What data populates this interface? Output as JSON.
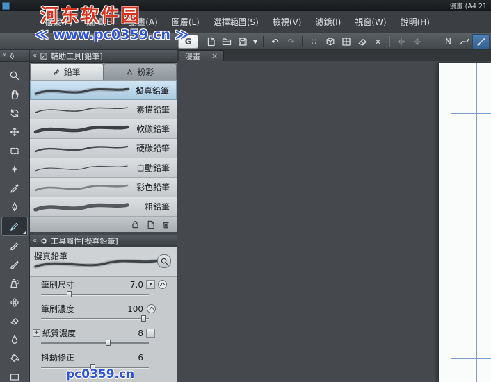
{
  "watermarks": {
    "top_title": "河东软件园",
    "top_url": "≪ www.pc0359.cn ≫",
    "bottom_url": "pc0359.cn"
  },
  "titlebar": {
    "title": "漫畫 (A4 21"
  },
  "menubar": {
    "items": [
      "檔案(F)",
      "編輯(E)",
      "動畫(A)",
      "圖層(L)",
      "選擇範圍(S)",
      "檢視(V)",
      "濾鏡(I)",
      "視窗(W)",
      "說明(H)"
    ]
  },
  "toolbar": {
    "logo_glyph": "G",
    "dropdown_glyph": "▾",
    "undo_glyph": "↶",
    "redo_glyph": "↷",
    "snap_dots_glyph": "∷",
    "deselect_glyph": "×",
    "line_letter": "N",
    "button_names": [
      "app-logo",
      "new",
      "open",
      "save",
      "save-options",
      "undo",
      "redo",
      "snap-ruler",
      "snap-3d",
      "snap-grid",
      "eraser-clear",
      "deselect",
      "flip-horizontal",
      "flip-vertical",
      "line-tool",
      "curve-tool",
      "active-tool"
    ]
  },
  "tool_palette": {
    "tools": [
      "zoom",
      "hand",
      "rotate",
      "move",
      "selection",
      "auto-select",
      "eyedropper",
      "pen",
      "pencil",
      "brush",
      "watercolor",
      "airbrush",
      "decoration",
      "eraser",
      "blend",
      "fill",
      "gradient"
    ],
    "selected": "pencil"
  },
  "subtool": {
    "title": "輔助工具[鉛筆]",
    "tabs": [
      {
        "label": "鉛筆"
      },
      {
        "label": "粉彩"
      }
    ],
    "active_tab": "鉛筆",
    "brushes": [
      {
        "label": "擬真鉛筆"
      },
      {
        "label": "素描鉛筆"
      },
      {
        "label": "軟碳鉛筆"
      },
      {
        "label": "硬碳鉛筆"
      },
      {
        "label": "自動鉛筆"
      },
      {
        "label": "彩色鉛筆"
      },
      {
        "label": "粗鉛筆"
      }
    ],
    "selected_brush": "擬真鉛筆",
    "footer_icons": [
      "lock",
      "new-page",
      "trash"
    ]
  },
  "tool_property": {
    "title": "工具屬性[擬真鉛筆]",
    "brush_name": "擬真鉛筆",
    "params": [
      {
        "label": "筆刷尺寸",
        "value": "7.0"
      },
      {
        "label": "筆刷濃度",
        "value": "100"
      },
      {
        "label": "紙質濃度",
        "value": "8"
      },
      {
        "label": "抖動修正",
        "value": "6"
      }
    ]
  },
  "canvas": {
    "tab": "漫畫",
    "close_glyph": "×"
  },
  "ui_glyphs": {
    "collapse": "«",
    "dropdown": "▾",
    "plus": "+"
  },
  "colors": {
    "accent_blue": "#3478b6",
    "selection_blue": "#b9d3e8",
    "canvas_bg": "#45484c",
    "guide_blue": "#7e9ccd",
    "watermark_red": "#d8321e",
    "watermark_blue": "#2f55d4"
  }
}
